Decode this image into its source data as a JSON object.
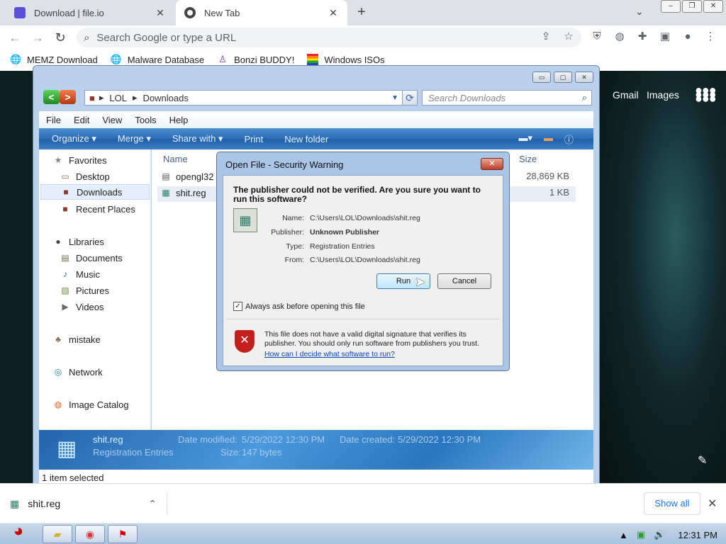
{
  "browser": {
    "tabs": [
      {
        "title": "Download | file.io",
        "favicon": "file-io-icon",
        "close": "✕"
      },
      {
        "title": "New Tab",
        "favicon": "chrome-icon",
        "close": "✕"
      }
    ],
    "new_tab": "+",
    "omnibox_placeholder": "Search Google or type a URL",
    "bookmarks": [
      {
        "label": "MEMZ Download",
        "icon": "globe-icon"
      },
      {
        "label": "Malware Database",
        "icon": "globe-icon"
      },
      {
        "label": "Bonzi BUDDY!",
        "icon": "bonzi-icon"
      },
      {
        "label": "Windows ISOs",
        "icon": "windows-icon"
      }
    ]
  },
  "newtab_page": {
    "gmail": "Gmail",
    "images": "Images"
  },
  "explorer": {
    "breadcrumb": [
      "LOL",
      "Downloads"
    ],
    "search_placeholder": "Search Downloads",
    "menu": [
      "File",
      "Edit",
      "View",
      "Tools",
      "Help"
    ],
    "commands": [
      "Organize ▾",
      "Merge ▾",
      "Share with ▾",
      "Print",
      "New folder"
    ],
    "nav": {
      "favorites": "Favorites",
      "desktop": "Desktop",
      "downloads": "Downloads",
      "recent": "Recent Places",
      "libraries": "Libraries",
      "documents": "Documents",
      "music": "Music",
      "pictures": "Pictures",
      "videos": "Videos",
      "mistake": "mistake",
      "network": "Network",
      "image_catalog": "Image Catalog"
    },
    "columns": {
      "name": "Name",
      "size": "Size"
    },
    "files": [
      {
        "name": "opengl32",
        "size": "28,869 KB"
      },
      {
        "name": "shit.reg",
        "size": "1 KB"
      }
    ],
    "details": {
      "filename": "shit.reg",
      "type": "Registration Entries",
      "date_modified_label": "Date modified:",
      "date_modified": "5/29/2022 12:30 PM",
      "date_created_label": "Date created:",
      "date_created": "5/29/2022 12:30 PM",
      "size_label": "Size:",
      "size": "147 bytes"
    },
    "status": "1 item selected"
  },
  "dialog": {
    "title": "Open File - Security Warning",
    "headline": "The publisher could not be verified.  Are you sure you want to run this software?",
    "fields": [
      {
        "label": "Name:",
        "value": "C:\\Users\\LOL\\Downloads\\shit.reg"
      },
      {
        "label": "Publisher:",
        "value": "Unknown Publisher"
      },
      {
        "label": "Type:",
        "value": "Registration Entries"
      },
      {
        "label": "From:",
        "value": "C:\\Users\\LOL\\Downloads\\shit.reg"
      }
    ],
    "run_label": "Run",
    "cancel_label": "Cancel",
    "always_ask": "Always ask before opening this file",
    "always_ask_checked": true,
    "warning": "This file does not have a valid digital signature that verifies its publisher.  You should only run software from publishers you trust.",
    "link": "How can I decide what software to run?"
  },
  "downloads_bar": {
    "item": "shit.reg",
    "show_all": "Show all"
  },
  "taskbar": {
    "clock": "12:31 PM"
  },
  "colors": {
    "accent": "#1a73e8",
    "explorer_frame": "#b9d1ea",
    "command_bar": "#2a6cb5",
    "danger": "#c41f1f"
  }
}
